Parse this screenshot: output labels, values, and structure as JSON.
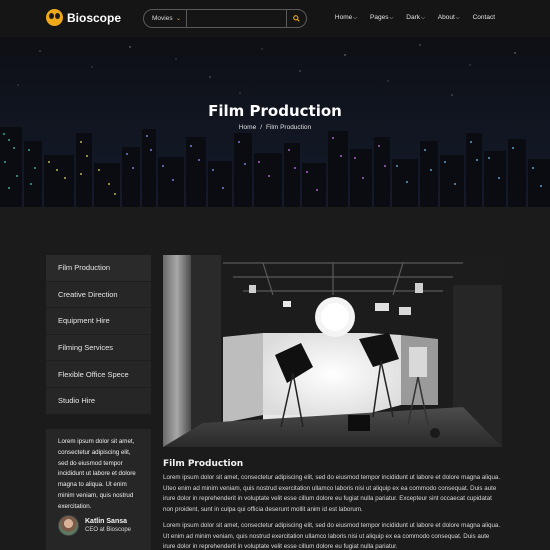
{
  "brand": {
    "name": "Bioscope"
  },
  "search": {
    "category": "Movies",
    "placeholder": ""
  },
  "nav": [
    {
      "label": "Home",
      "dropdown": true
    },
    {
      "label": "Pages",
      "dropdown": true
    },
    {
      "label": "Dark",
      "dropdown": true
    },
    {
      "label": "About",
      "dropdown": true
    },
    {
      "label": "Contact",
      "dropdown": false
    }
  ],
  "hero": {
    "title": "Film Production",
    "breadcrumb": {
      "home": "Home",
      "separator": "/",
      "current": "Film Production"
    }
  },
  "sidebar": {
    "items": [
      {
        "label": "Film Production"
      },
      {
        "label": "Creative Direction"
      },
      {
        "label": "Equipment Hire"
      },
      {
        "label": "Filming Services"
      },
      {
        "label": "Flexible Office Spece"
      },
      {
        "label": "Studio Hire"
      }
    ]
  },
  "testimonial": {
    "text": "Lorem ipsum dolor sit amet, consectetur adipiscing elit, sed do eiusmod tempor incididunt ut labore et dolore magna to aliqua. Ut enim minim veniam, quis nostrud exercitation.",
    "name": "Katlin Sansa",
    "role": "CEO at Bioscope"
  },
  "content": {
    "title": "Film Production",
    "paragraph1": "Lorem ipsum dolor sit amet, consectetur adipiscing elit, sed do eiusmod tempor incididunt ut labore et dolore magna aliqua. Uteo enim ad minim veniam, quis nostrud exercitation ullamco laboris nisi ut aliquip ex ea commodo consequat. Duis aute irure dolor in reprehenderit in voluptate velit esse cillum dolore eu fugiat nulla pariatur. Excepteur sint occaecat cupidatat non proident, sunt in culpa qui officia deserunt mollit anim id est laborum.",
    "paragraph2": "Lorem ipsum dolor sit amet, consectetur adipiscing elit, sed do eiusmod tempor incididunt ut labore et dolore magna aliqua. Ut enim ad minim veniam, quis nostrud exercitation ullamco laboris nisi ut aliquip ex ea commodo consequat. Duis aute irure dolor in reprehenderit in voluptate velit esse cillum dolore eu fugiat nulla pariatur."
  },
  "colors": {
    "accent": "#f0a81b",
    "panel": "#262626",
    "background": "#1b1b1b"
  },
  "icons": {
    "search": "search-icon",
    "logo": "owl-logo-icon",
    "chevron": "chevron-down-icon"
  }
}
